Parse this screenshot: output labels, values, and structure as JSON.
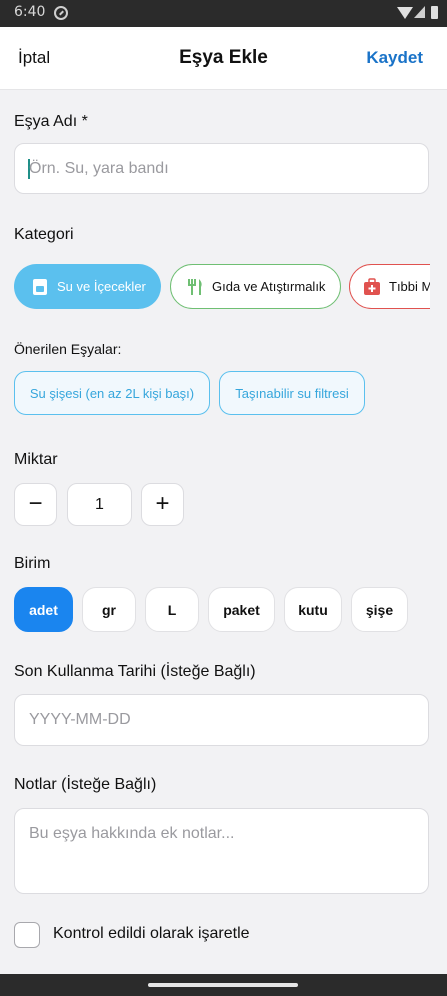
{
  "status_bar": {
    "time": "6:40"
  },
  "header": {
    "cancel": "İptal",
    "title": "Eşya Ekle",
    "save": "Kaydet"
  },
  "item_name": {
    "label": "Eşya Adı *",
    "placeholder": "Örn. Su, yara bandı"
  },
  "category": {
    "label": "Kategori",
    "chips": [
      {
        "label": "Su ve İçecekler",
        "icon": "cup-icon",
        "color": "#5bc0ee",
        "selected": true
      },
      {
        "label": "Gıda ve Atıştırmalık",
        "icon": "fork-knife-icon",
        "color": "#6fbf73",
        "selected": false
      },
      {
        "label": "Tıbbi Malzemeler",
        "icon": "medkit-icon",
        "color": "#e0524f",
        "selected": false
      }
    ]
  },
  "suggested": {
    "label": "Önerilen Eşyalar:",
    "items": [
      "Su şişesi (en az 2L kişi başı)",
      "Taşınabilir su filtresi"
    ]
  },
  "quantity": {
    "label": "Miktar",
    "minus": "−",
    "value": "1",
    "plus": "+"
  },
  "unit": {
    "label": "Birim",
    "options": [
      "adet",
      "gr",
      "L",
      "paket",
      "kutu",
      "şişe"
    ],
    "selected": "adet"
  },
  "expiry": {
    "label": "Son Kullanma Tarihi (İsteğe Bağlı)",
    "placeholder": "YYYY-MM-DD"
  },
  "notes": {
    "label": "Notlar (İsteğe Bağlı)",
    "placeholder": "Bu eşya hakkında ek notlar..."
  },
  "checked": {
    "label": "Kontrol edildi olarak işaretle",
    "value": false
  },
  "colors": {
    "accent": "#1a85ef",
    "save_link": "#1a73c8",
    "suggest": "#36a6dc"
  }
}
